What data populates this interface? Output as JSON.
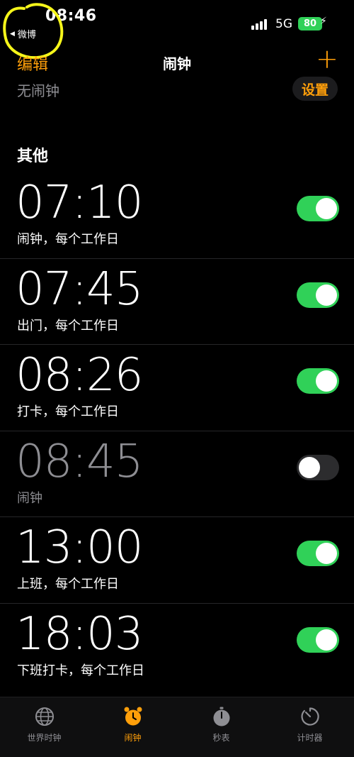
{
  "status_bar": {
    "time": "08:46",
    "back_app": "微博",
    "network": "5G",
    "battery": "80"
  },
  "nav": {
    "edit": "编辑",
    "title": "闹钟",
    "add": "+"
  },
  "sleep": {
    "label": "无闹钟",
    "button": "设置"
  },
  "section_title": "其他",
  "alarms": [
    {
      "time": "07:10",
      "label": "闹钟，每个工作日",
      "enabled": true
    },
    {
      "time": "07:45",
      "label": "出门，每个工作日",
      "enabled": true
    },
    {
      "time": "08:26",
      "label": "打卡，每个工作日",
      "enabled": true
    },
    {
      "time": "08:45",
      "label": "闹钟",
      "enabled": false
    },
    {
      "time": "13:00",
      "label": "上班，每个工作日",
      "enabled": true
    },
    {
      "time": "18:03",
      "label": "下班打卡，每个工作日",
      "enabled": true
    }
  ],
  "tabs": [
    {
      "label": "世界时钟",
      "icon": "globe-icon",
      "active": false
    },
    {
      "label": "闹钟",
      "icon": "alarm-clock-icon",
      "active": true
    },
    {
      "label": "秒表",
      "icon": "stopwatch-icon",
      "active": false
    },
    {
      "label": "计时器",
      "icon": "timer-icon",
      "active": false
    }
  ],
  "colors": {
    "accent": "#ff9f0a",
    "toggle_on": "#30d158",
    "background": "#000000",
    "annotation": "#f5f51a"
  }
}
